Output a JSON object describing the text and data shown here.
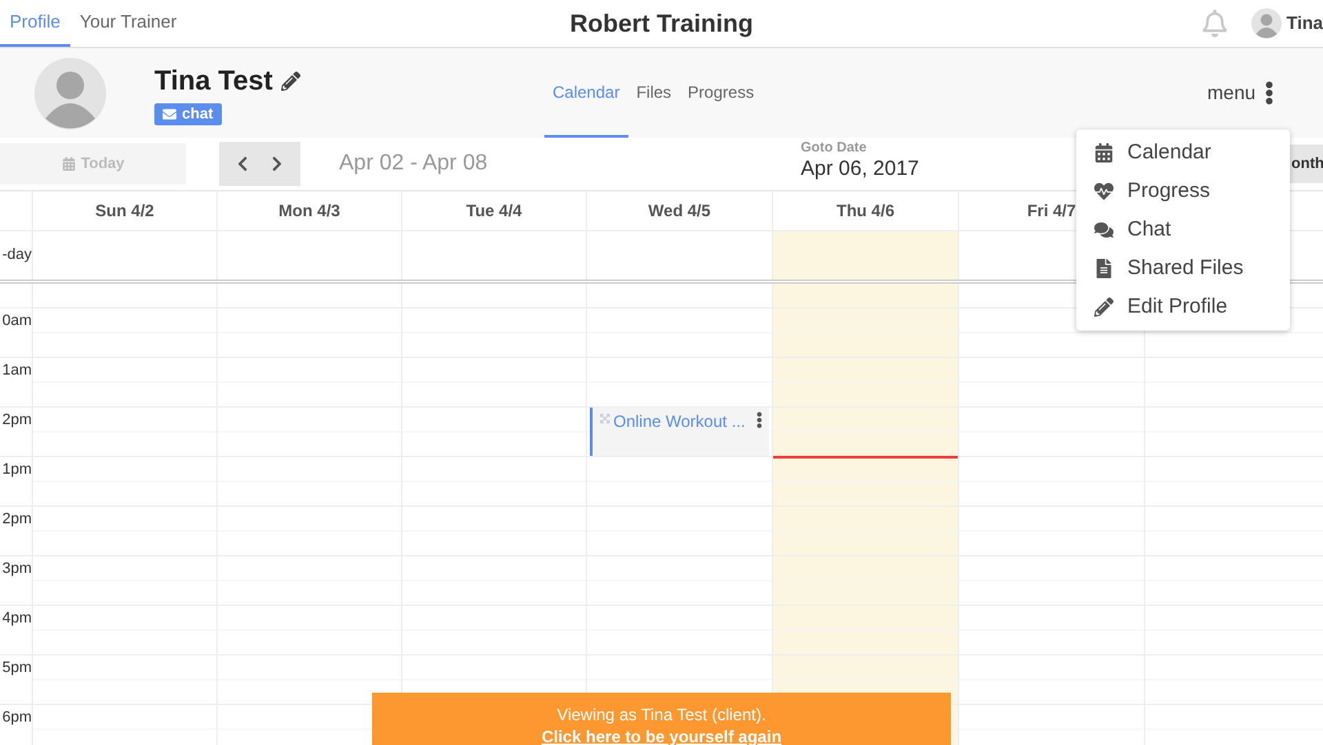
{
  "top_nav": {
    "tabs": [
      {
        "label": "Profile",
        "selected": true
      },
      {
        "label": "Your Trainer",
        "selected": false
      }
    ],
    "title": "Robert Training",
    "user_name": "Tina"
  },
  "profile": {
    "name": "Tina Test",
    "chat_label": "chat",
    "tabs": [
      {
        "label": "Calendar",
        "selected": true
      },
      {
        "label": "Files",
        "selected": false
      },
      {
        "label": "Progress",
        "selected": false
      }
    ],
    "menu_label": "menu"
  },
  "toolbar": {
    "today_label": "Today",
    "today_disabled": true,
    "range": "Apr 02 - Apr 08",
    "goto_label": "Goto Date",
    "goto_value": "Apr 06, 2017",
    "view_button": "onth"
  },
  "calendar": {
    "all_day_label": "-day",
    "days": [
      {
        "label": "Sun 4/2",
        "today": false
      },
      {
        "label": "Mon 4/3",
        "today": false
      },
      {
        "label": "Tue 4/4",
        "today": false
      },
      {
        "label": "Wed 4/5",
        "today": false,
        "events": [
          {
            "title": "Online Workout ..."
          }
        ]
      },
      {
        "label": "Thu 4/6",
        "today": true
      },
      {
        "label": "Fri 4/7",
        "today": false
      }
    ],
    "times": [
      "0am",
      "1am",
      "2pm",
      "1pm",
      "2pm",
      "3pm",
      "4pm",
      "5pm",
      "6pm"
    ]
  },
  "menu": {
    "items": [
      {
        "label": "Calendar",
        "kind": "calendar"
      },
      {
        "label": "Progress",
        "kind": "progress"
      },
      {
        "label": "Chat",
        "kind": "chat"
      },
      {
        "label": "Shared Files",
        "kind": "files"
      },
      {
        "label": "Edit Profile",
        "kind": "edit"
      }
    ]
  },
  "banner": {
    "text": "Viewing as Tina Test (client).",
    "link": "Click here to be yourself again"
  }
}
